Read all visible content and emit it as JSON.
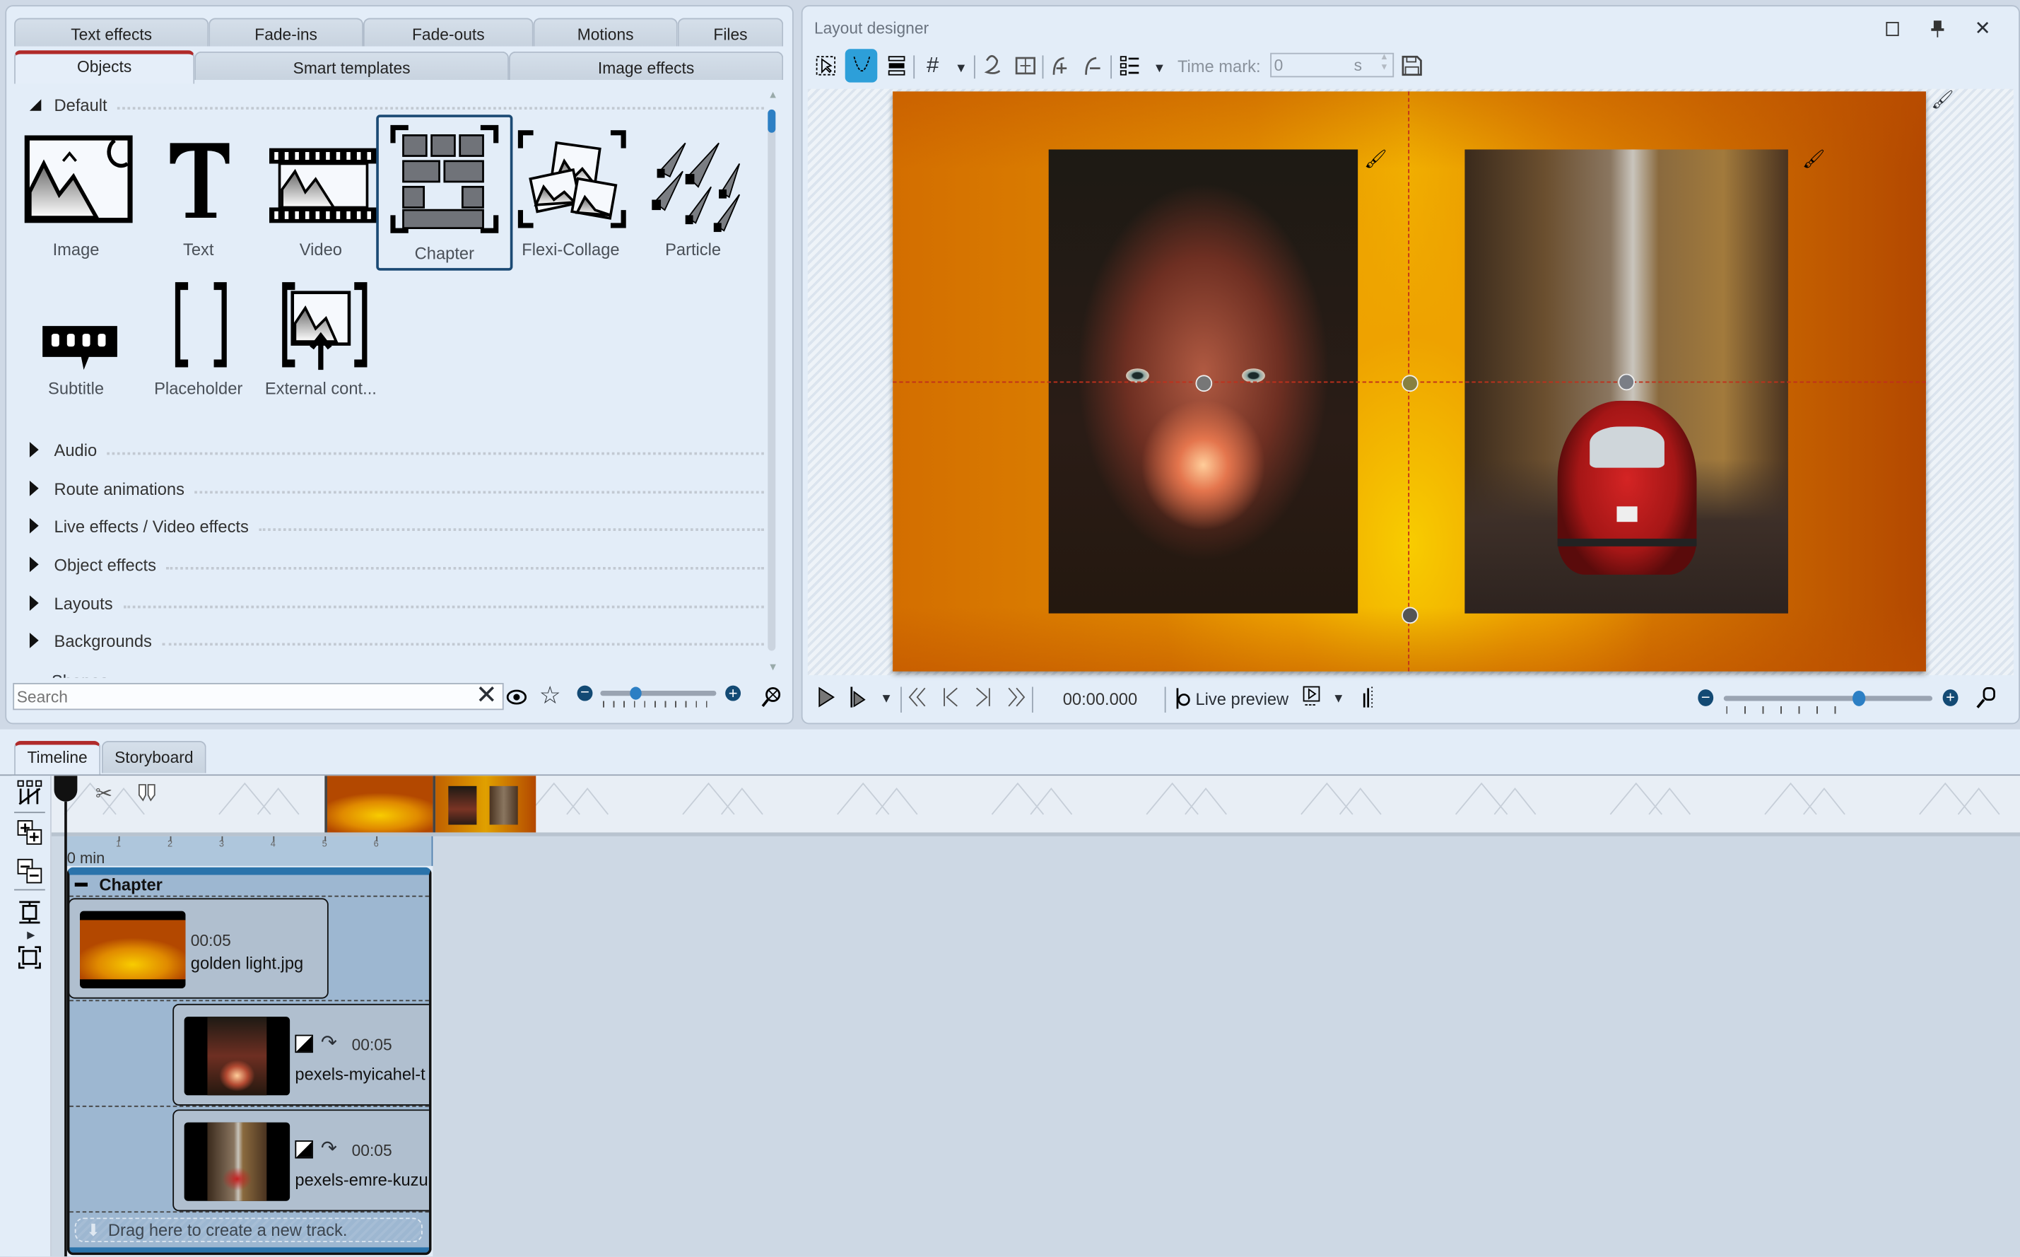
{
  "left_panel": {
    "tabs_row1": [
      "Text effects",
      "Fade-ins",
      "Fade-outs",
      "Motions",
      "Files"
    ],
    "tabs_row2": [
      "Objects",
      "Smart templates",
      "Image effects"
    ],
    "active_tab": "Objects",
    "default_section": "Default",
    "objects": [
      {
        "label": "Image",
        "icon": "image-icon"
      },
      {
        "label": "Text",
        "icon": "text-icon"
      },
      {
        "label": "Video",
        "icon": "video-icon"
      },
      {
        "label": "Chapter",
        "icon": "chapter-icon",
        "selected": true
      },
      {
        "label": "Flexi-Collage",
        "icon": "flexi-collage-icon"
      },
      {
        "label": "Particle",
        "icon": "particle-icon"
      },
      {
        "label": "Subtitle",
        "icon": "subtitle-icon"
      },
      {
        "label": "Placeholder",
        "icon": "placeholder-icon"
      },
      {
        "label": "External cont...",
        "icon": "external-content-icon"
      }
    ],
    "categories": [
      "Audio",
      "Route animations",
      "Live effects / Video effects",
      "Object effects",
      "Layouts",
      "Backgrounds",
      "Shapes"
    ],
    "search_placeholder": "Search",
    "search_value": "",
    "zoom_slider_value": 0.3
  },
  "layout_designer": {
    "title": "Layout designer",
    "time_mark_label": "Time mark:",
    "time_mark_value": "0",
    "time_mark_unit": "s",
    "timecode": "00:00.000",
    "live_preview_label": "Live preview",
    "zoom_slider_value": 0.65,
    "accent": "#2d9fd9"
  },
  "bottom": {
    "tabs": [
      "Timeline",
      "Storyboard"
    ],
    "active_tab": "Timeline",
    "ruler_unit": "0 min",
    "ruler_ticks": [
      "1",
      "2",
      "3",
      "4",
      "5",
      "6"
    ],
    "chapter_label": "Chapter",
    "clips": [
      {
        "duration": "00:05",
        "name": "golden light.jpg"
      },
      {
        "duration": "00:05",
        "name": "pexels-myicahel-t"
      },
      {
        "duration": "00:05",
        "name": "pexels-emre-kuzu"
      }
    ],
    "drop_hint": "Drag here to create a new track."
  }
}
